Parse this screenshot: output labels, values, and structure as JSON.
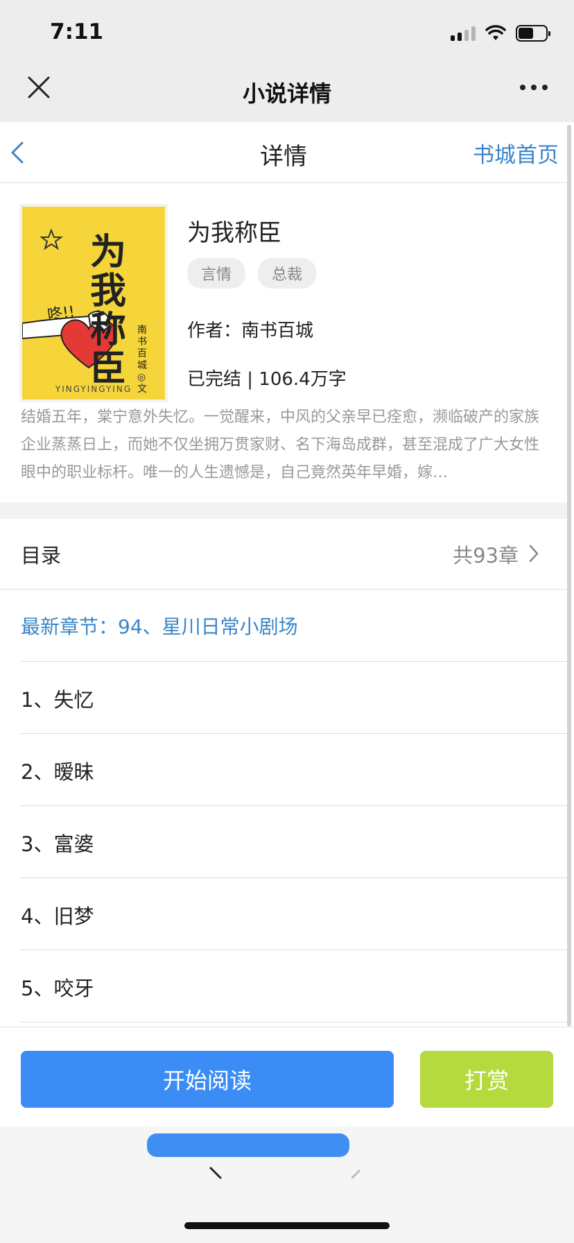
{
  "status_bar": {
    "time": "7:11"
  },
  "wechat_header": {
    "title": "小说详情"
  },
  "page_nav": {
    "title": "详情",
    "home_link": "书城首页"
  },
  "book": {
    "cover": {
      "title": "为我称臣",
      "author_vertical": "南书百城◎文",
      "shout": "咚!!",
      "footer": "YINGYINGYING",
      "background_color": "#f5d53a"
    },
    "title": "为我称臣",
    "tags": [
      "言情",
      "总裁"
    ],
    "author": "作者：南书百城",
    "status": "已完结 | 106.4万字",
    "synopsis": "结婚五年，棠宁意外失忆。一觉醒来，中风的父亲早已痊愈，濒临破产的家族企业蒸蒸日上，而她不仅坐拥万贯家财、名下海岛成群，甚至混成了广大女性眼中的职业标杆。唯一的人生遗憾是，自己竟然英年早婚，嫁…"
  },
  "catalog": {
    "label": "目录",
    "count": "共93章",
    "latest": "最新章节：94、星川日常小剧场",
    "chapters": [
      "1、失忆",
      "2、暧昧",
      "3、富婆",
      "4、旧梦",
      "5、咬牙"
    ]
  },
  "actions": {
    "read_label": "开始阅读",
    "reward_label": "打赏",
    "read_color": "#3b8cf5",
    "reward_color": "#b4da3e"
  },
  "colors": {
    "link_blue": "#3a85c8"
  },
  "icons": [
    "close-icon",
    "more-icon",
    "back-chevron-icon",
    "chevron-right-icon",
    "signal-icon",
    "wifi-icon",
    "battery-icon"
  ]
}
